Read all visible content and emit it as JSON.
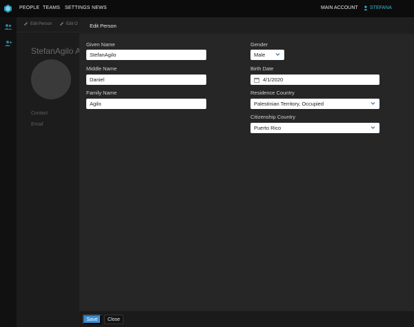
{
  "nav": {
    "items": [
      "PEOPLE",
      "TEAMS",
      "SETTINGS",
      "NEWS"
    ],
    "account": "MAIN ACCOUNT",
    "user": "STEFANA"
  },
  "background": {
    "toolbar": [
      "Edit Person",
      "Edit O"
    ],
    "person_name": "StefanAgilo A",
    "contact_label": "Contact",
    "email_label": "Email"
  },
  "modal": {
    "title": "Edit Person",
    "fields": {
      "given_name": {
        "label": "Given Name",
        "value": "StefanAgilo"
      },
      "middle_name": {
        "label": "Middle Name",
        "value": "Daniel"
      },
      "family_name": {
        "label": "Family Name",
        "value": "Agilo"
      },
      "gender": {
        "label": "Gender",
        "value": "Male"
      },
      "birth_date": {
        "label": "Birth Date",
        "value": "4/1/2020"
      },
      "residence_country": {
        "label": "Residence Country",
        "value": "Palestinian Territory, Occupied"
      },
      "citizenship_country": {
        "label": "Citizenship Country",
        "value": "Puerto Rico"
      }
    },
    "save_label": "Save",
    "close_label": "Close"
  },
  "colors": {
    "accent": "#3ab6d4",
    "primary_button": "#3a8fd6"
  }
}
